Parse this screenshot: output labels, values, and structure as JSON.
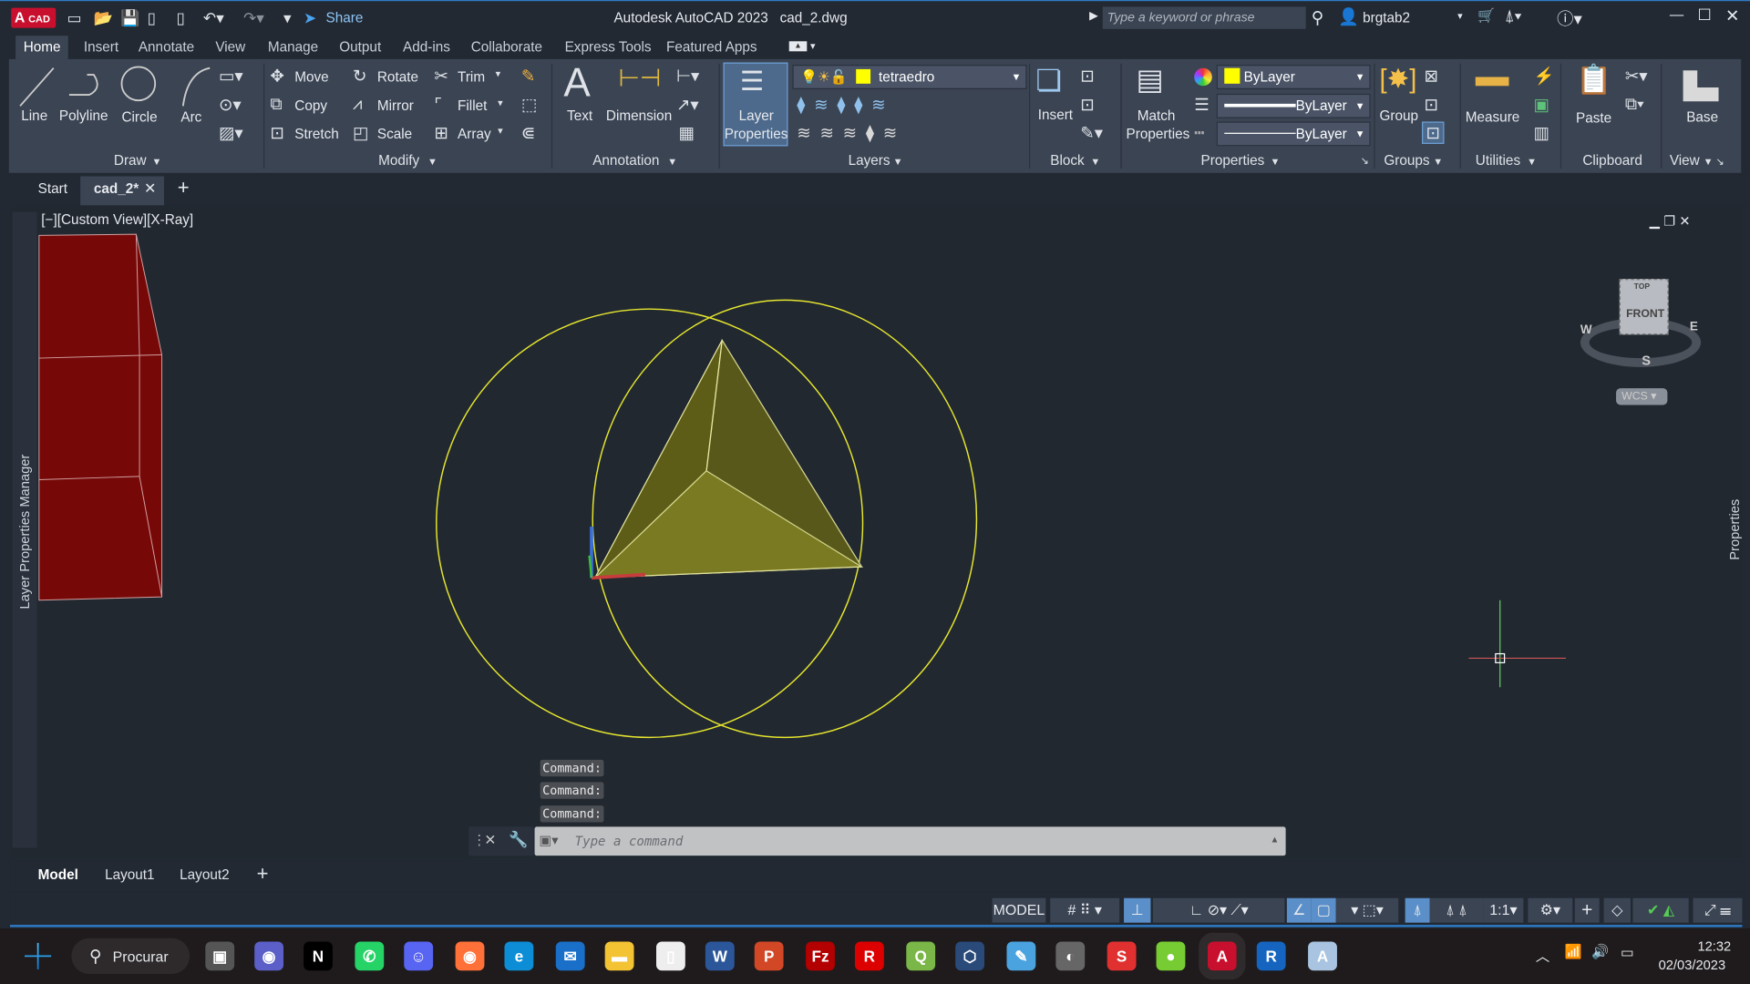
{
  "app": {
    "logo_text": "CAD",
    "title": "Autodesk AutoCAD 2023",
    "filename": "cad_2.dwg",
    "share_label": "Share",
    "search_placeholder": "Type a keyword or phrase",
    "user": "brgtab2"
  },
  "ribbon_tabs": [
    "Home",
    "Insert",
    "Annotate",
    "View",
    "Manage",
    "Output",
    "Add-ins",
    "Collaborate",
    "Express Tools",
    "Featured Apps"
  ],
  "ribbon": {
    "draw": {
      "label": "Draw",
      "line": "Line",
      "polyline": "Polyline",
      "circle": "Circle",
      "arc": "Arc"
    },
    "modify": {
      "label": "Modify",
      "move": "Move",
      "rotate": "Rotate",
      "trim": "Trim",
      "copy": "Copy",
      "mirror": "Mirror",
      "fillet": "Fillet",
      "stretch": "Stretch",
      "scale": "Scale",
      "array": "Array"
    },
    "annotation": {
      "label": "Annotation",
      "text": "Text",
      "dimension": "Dimension"
    },
    "layers": {
      "label": "Layers",
      "layer_properties_1": "Layer",
      "layer_properties_2": "Properties",
      "current_layer": "tetraedro",
      "layer_color": "#ffff00"
    },
    "block": {
      "label": "Block",
      "insert": "Insert"
    },
    "properties": {
      "label": "Properties",
      "match_1": "Match",
      "match_2": "Properties",
      "color": "ByLayer",
      "linetype": "ByLayer",
      "lineweight": "ByLayer"
    },
    "groups": {
      "label": "Groups",
      "group": "Group"
    },
    "utilities": {
      "label": "Utilities",
      "measure": "Measure"
    },
    "clipboard": {
      "label": "Clipboard",
      "paste": "Paste"
    },
    "view": {
      "label": "View",
      "base": "Base"
    }
  },
  "file_tabs": {
    "start": "Start",
    "active": "cad_2*"
  },
  "viewport": {
    "label": "[−][Custom View][X-Ray]",
    "left_palette": "Layer Properties Manager",
    "right_palette": "Properties",
    "viewcube": {
      "top": "TOP",
      "front": "FRONT",
      "w": "W",
      "e": "E",
      "s": "S",
      "wcs": "WCS"
    },
    "colors": {
      "background": "#212830",
      "circles": "#e6e62e",
      "tetrahedron": "#6e6e1c",
      "box": "#7a0a0a"
    }
  },
  "command": {
    "history": [
      "Command:",
      "Command:",
      "Command:"
    ],
    "placeholder": "Type a command"
  },
  "layout_tabs": [
    "Model",
    "Layout1",
    "Layout2"
  ],
  "status": {
    "model": "MODEL",
    "scale": "1:1"
  },
  "taskbar": {
    "search": "Procurar",
    "time": "12:32",
    "date": "02/03/2023",
    "apps": [
      "Task View",
      "Teams",
      "Netflix",
      "WhatsApp",
      "Discord",
      "Firefox",
      "Edge",
      "Thunderbird",
      "File Explorer",
      "LibreOffice",
      "Word",
      "PowerPoint",
      "FileZilla",
      "Revo",
      "QGIS",
      "VirtualBox",
      "Paint",
      "GIMP",
      "SketchUp",
      "Nero",
      "AutoCAD",
      "Revit",
      "Notepad"
    ]
  }
}
